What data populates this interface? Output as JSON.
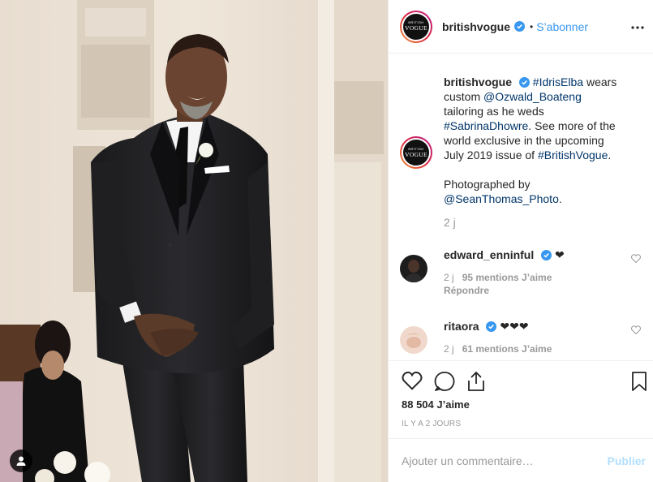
{
  "post": {
    "username": "britishvogue",
    "follow_label": "S’abonner",
    "separator": "•",
    "avatar_logo_top": "BRITISH",
    "avatar_logo_bottom": "VOGUE"
  },
  "caption": {
    "username": "britishvogue",
    "hashtag1": "#IdrisElba",
    "text1": " wears custom ",
    "mention1": "@Ozwald_Boateng",
    "text2": " tailoring as he weds ",
    "hashtag2": "#SabrinaDhowre",
    "text3": ". See more of the world exclusive in the upcoming July 2019 issue of ",
    "hashtag3": "#BritishVogue",
    "text4": ".",
    "credit_text": "Photographed by ",
    "mention2": "@SeanThomas_Photo",
    "credit_end": ".",
    "time": "2 j"
  },
  "comments": [
    {
      "username": "edward_enninful",
      "text": "❤",
      "time": "2 j",
      "likes": "95 mentions J’aime",
      "reply": "Répondre"
    },
    {
      "username": "ritaora",
      "text": "❤❤❤",
      "time": "2 j",
      "likes": "61 mentions J’aime"
    }
  ],
  "footer": {
    "likes_count": "88 504 J’aime",
    "posted_ago": "IL Y A 2 JOURS",
    "comment_placeholder": "Ajouter un commentaire…",
    "publish_label": "Publier"
  },
  "colors": {
    "link": "#003569",
    "follow": "#3897f0",
    "muted": "#999999",
    "publish_disabled": "#b2dffc"
  },
  "icons": [
    "user-tag-icon",
    "verified-icon",
    "more-options-icon",
    "heart-icon",
    "comment-icon",
    "share-icon",
    "bookmark-icon"
  ]
}
